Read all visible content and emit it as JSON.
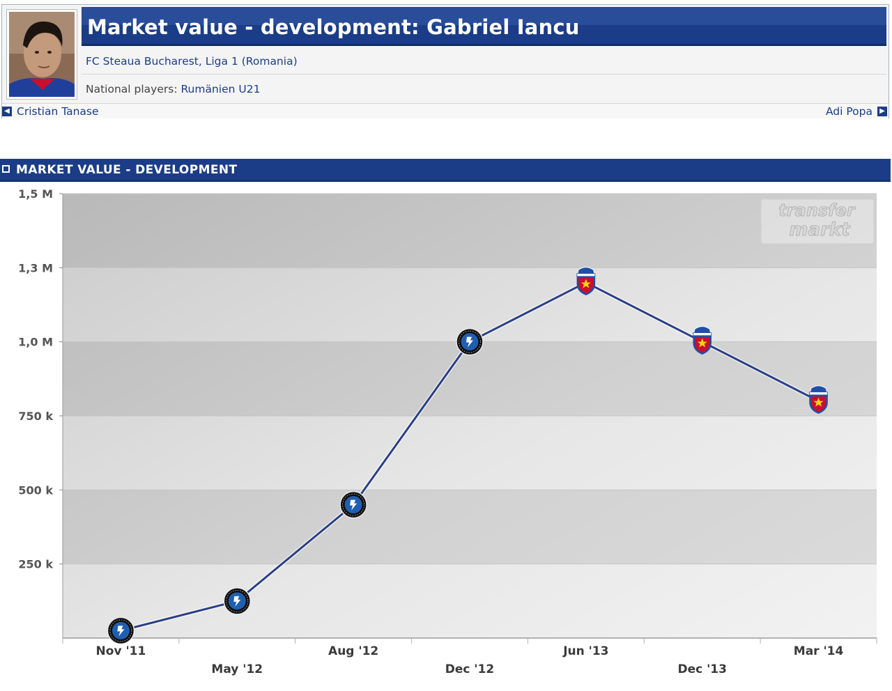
{
  "profile": {
    "title": "Market value - development: Gabriel Iancu",
    "club_line": "FC Steaua Bucharest, Liga 1 (Romania)",
    "national_label": "National players:",
    "national_value": "Rumänien U21",
    "prev_player": "Cristian Tanase",
    "next_player": "Adi Popa"
  },
  "section": {
    "title": "MARKET VALUE - DEVELOPMENT"
  },
  "watermark": {
    "line1": "transfer",
    "line2": "markt"
  },
  "colors": {
    "header_blue": "#1b3d87",
    "line_color": "#2a3f86",
    "club_a_dark": "#101010",
    "club_a_blue": "#1f5fb0",
    "club_b_red": "#c8102e",
    "club_b_blue": "#1f4fa8",
    "star_yellow": "#f7d117"
  },
  "chart_data": {
    "type": "line",
    "title": "",
    "xlabel": "",
    "ylabel": "",
    "ylim": [
      0,
      1500000
    ],
    "y_ticks": [
      {
        "value": 1500000,
        "label": "1,5 M"
      },
      {
        "value": 1250000,
        "label": "1,3 M"
      },
      {
        "value": 1000000,
        "label": "1,0 M"
      },
      {
        "value": 750000,
        "label": "750 k"
      },
      {
        "value": 500000,
        "label": "500 k"
      },
      {
        "value": 250000,
        "label": "250 k"
      }
    ],
    "grid": true,
    "legend": "none",
    "categories": [
      "Nov '11",
      "May '12",
      "Aug '12",
      "Dec '12",
      "Jun '13",
      "Dec '13",
      "Mar '14"
    ],
    "series": [
      {
        "values": [
          25000,
          125000,
          450000,
          1000000,
          1200000,
          1000000,
          800000
        ],
        "club_icons": [
          "club-a",
          "club-a",
          "club-a",
          "club-a",
          "club-b",
          "club-b",
          "club-b"
        ]
      }
    ]
  }
}
